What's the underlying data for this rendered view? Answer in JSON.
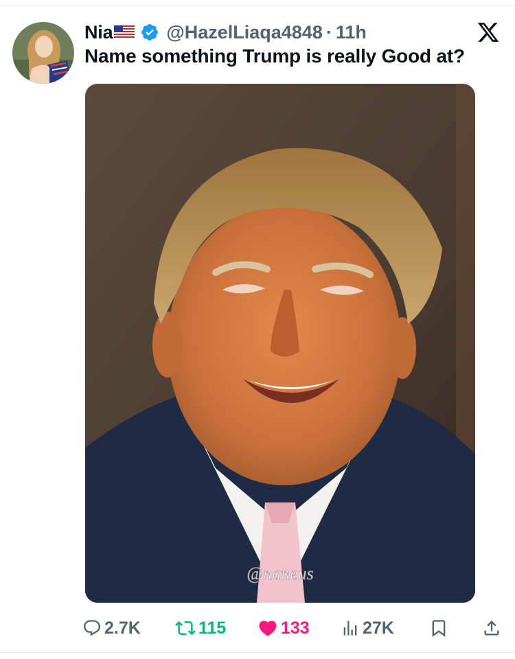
{
  "tweet": {
    "author_name": "Nia",
    "handle": "@HazelLiaqa4848",
    "separator": "·",
    "time": "11h",
    "text": "Name something Trump is really Good at?",
    "watermark": "@naneus"
  },
  "stats": {
    "replies": "2.7K",
    "retweets": "115",
    "likes": "133",
    "views": "27K"
  },
  "colors": {
    "verified": "#1d9bf0",
    "retweet": "#00ba7c",
    "like": "#f91880",
    "muted": "#536471"
  },
  "icons": {
    "author_flag": "us-flag-icon",
    "verified": "verified-badge-icon",
    "platform": "x-logo-icon",
    "reply": "reply-icon",
    "retweet": "retweet-icon",
    "like": "heart-icon",
    "views": "views-chart-icon",
    "bookmark": "bookmark-icon",
    "share": "share-icon"
  }
}
